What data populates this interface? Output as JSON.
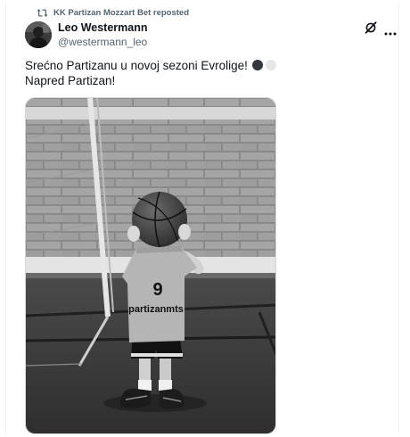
{
  "repost": {
    "icon": "repost-icon",
    "text": "KK Partizan Mozzart Bet reposted"
  },
  "author": {
    "name": "Leo Westermann",
    "handle": "@westermann_leo"
  },
  "tweet": {
    "line1": "Srećno Partizanu u novoj sezoni Evrolige!",
    "line2": "Napred Partizan!",
    "emoji_colors": [
      "#31373d",
      "#e6e7e8"
    ]
  },
  "media": {
    "jersey_number": "9",
    "jersey_text": "partizanmts"
  },
  "colors": {
    "text_primary": "#0f1419",
    "text_secondary": "#536471",
    "border": "#cfd9de"
  }
}
